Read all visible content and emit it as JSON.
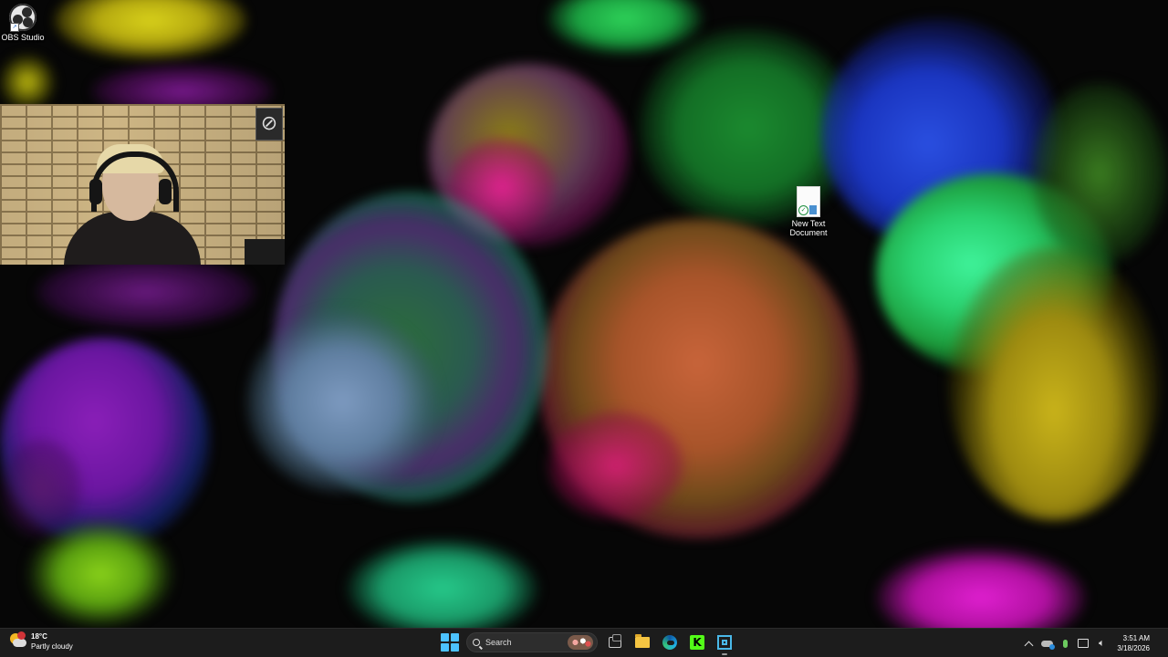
{
  "desktop": {
    "icons": [
      {
        "label": "OBS Studio",
        "icon": "obs-studio-icon"
      },
      {
        "label": "New Text Document",
        "icon": "text-document-icon"
      }
    ]
  },
  "webcam": {
    "overlay_logo": "stream-overlay-logo-icon"
  },
  "taskbar": {
    "weather": {
      "temp": "18°C",
      "condition": "Partly cloudy",
      "icon": "partly-cloudy-icon"
    },
    "search": {
      "label": "Search"
    },
    "apps": [
      "start-icon",
      "task-view-icon",
      "file-explorer-icon",
      "edge-icon",
      "kick-icon",
      "snipping-tool-icon"
    ],
    "kick_glyph": "K",
    "tray": [
      "show-hidden-icons-icon",
      "onedrive-icon",
      "microphone-icon",
      "network-icon",
      "speaker-icon"
    ],
    "clock": {
      "time": "3:51 AM",
      "date": "3/18/2026"
    }
  },
  "colors": {
    "taskbar_bg": "#1c1c1c",
    "start_accent": "#4cc2ff",
    "kick_green": "#53fc18"
  }
}
